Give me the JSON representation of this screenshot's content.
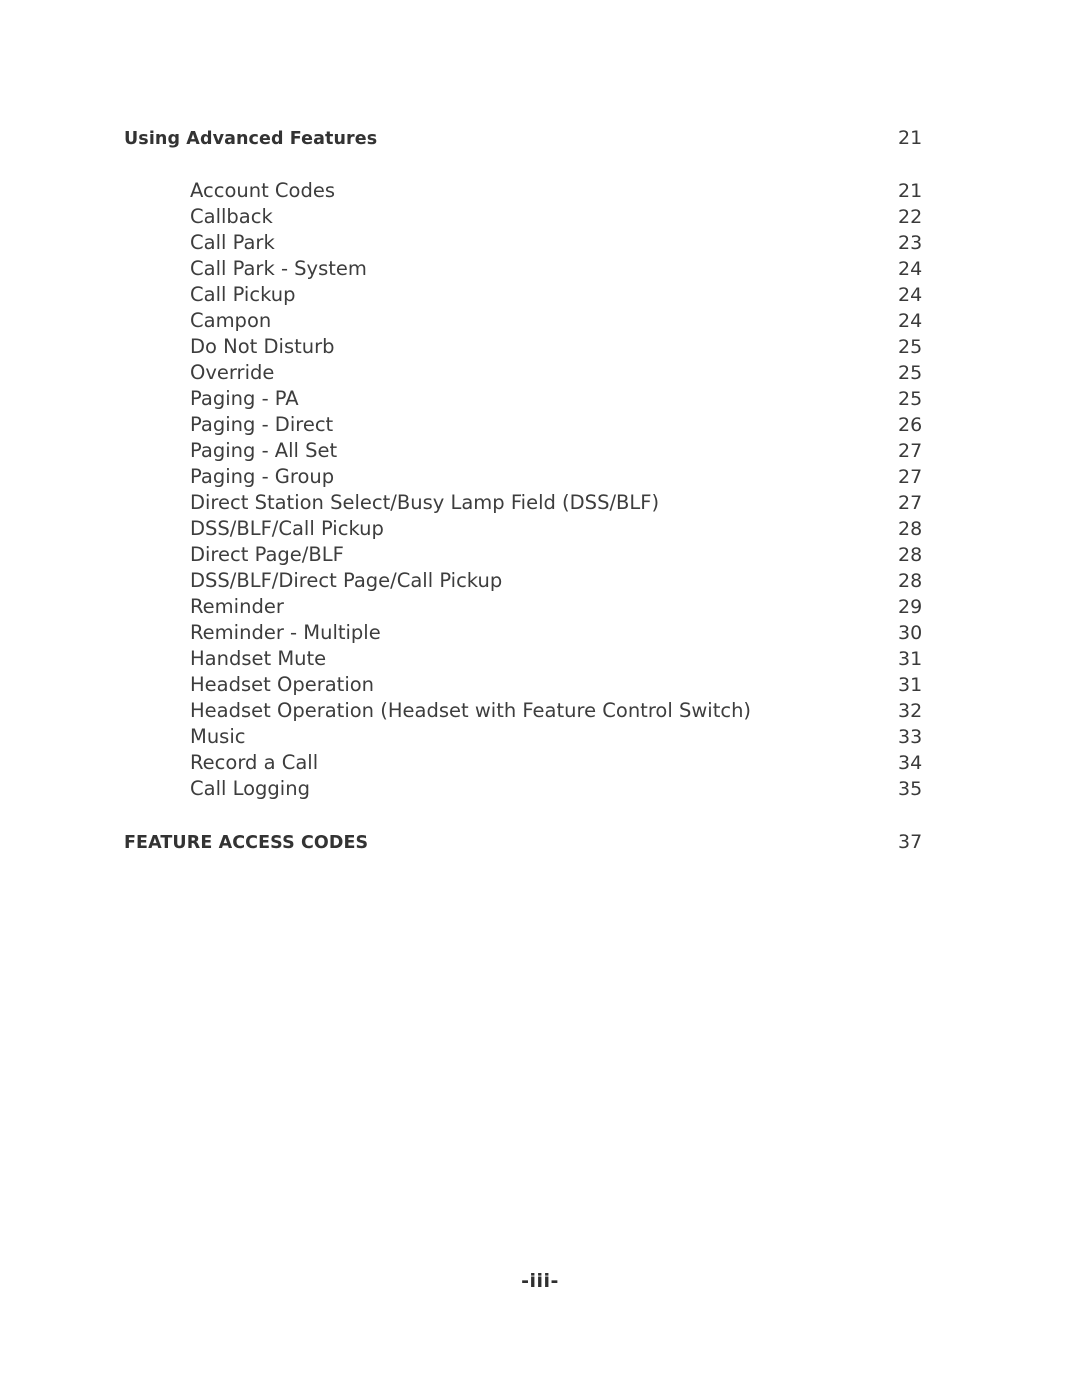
{
  "document": {
    "type": "table-of-contents",
    "folio": "-iii-"
  },
  "toc": {
    "sections": [
      {
        "title": "Using Advanced Features",
        "page": "21",
        "entries": [
          {
            "title": "Account Codes",
            "page": "21"
          },
          {
            "title": "Callback",
            "page": "22"
          },
          {
            "title": "Call Park",
            "page": "23"
          },
          {
            "title": "Call Park - System",
            "page": "24"
          },
          {
            "title": "Call Pickup",
            "page": "24"
          },
          {
            "title": "Campon",
            "page": "24"
          },
          {
            "title": "Do Not Disturb",
            "page": "25"
          },
          {
            "title": "Override",
            "page": "25"
          },
          {
            "title": "Paging - PA",
            "page": "25"
          },
          {
            "title": "Paging - Direct",
            "page": "26"
          },
          {
            "title": "Paging - All Set",
            "page": "27"
          },
          {
            "title": "Paging - Group",
            "page": "27"
          },
          {
            "title": "Direct Station Select/Busy Lamp Field (DSS/BLF)",
            "page": "27"
          },
          {
            "title": "DSS/BLF/Call Pickup",
            "page": "28"
          },
          {
            "title": "Direct Page/BLF",
            "page": "28"
          },
          {
            "title": "DSS/BLF/Direct Page/Call Pickup",
            "page": "28"
          },
          {
            "title": "Reminder",
            "page": "29"
          },
          {
            "title": "Reminder - Multiple",
            "page": "30"
          },
          {
            "title": "Handset Mute",
            "page": "31"
          },
          {
            "title": "Headset Operation",
            "page": "31"
          },
          {
            "title": "Headset Operation (Headset with Feature Control Switch)",
            "page": "32"
          },
          {
            "title": "Music",
            "page": "33"
          },
          {
            "title": "Record a Call",
            "page": "34"
          },
          {
            "title": "Call Logging",
            "page": "35"
          }
        ]
      },
      {
        "title": "FEATURE ACCESS CODES",
        "page": "37",
        "entries": []
      }
    ]
  }
}
